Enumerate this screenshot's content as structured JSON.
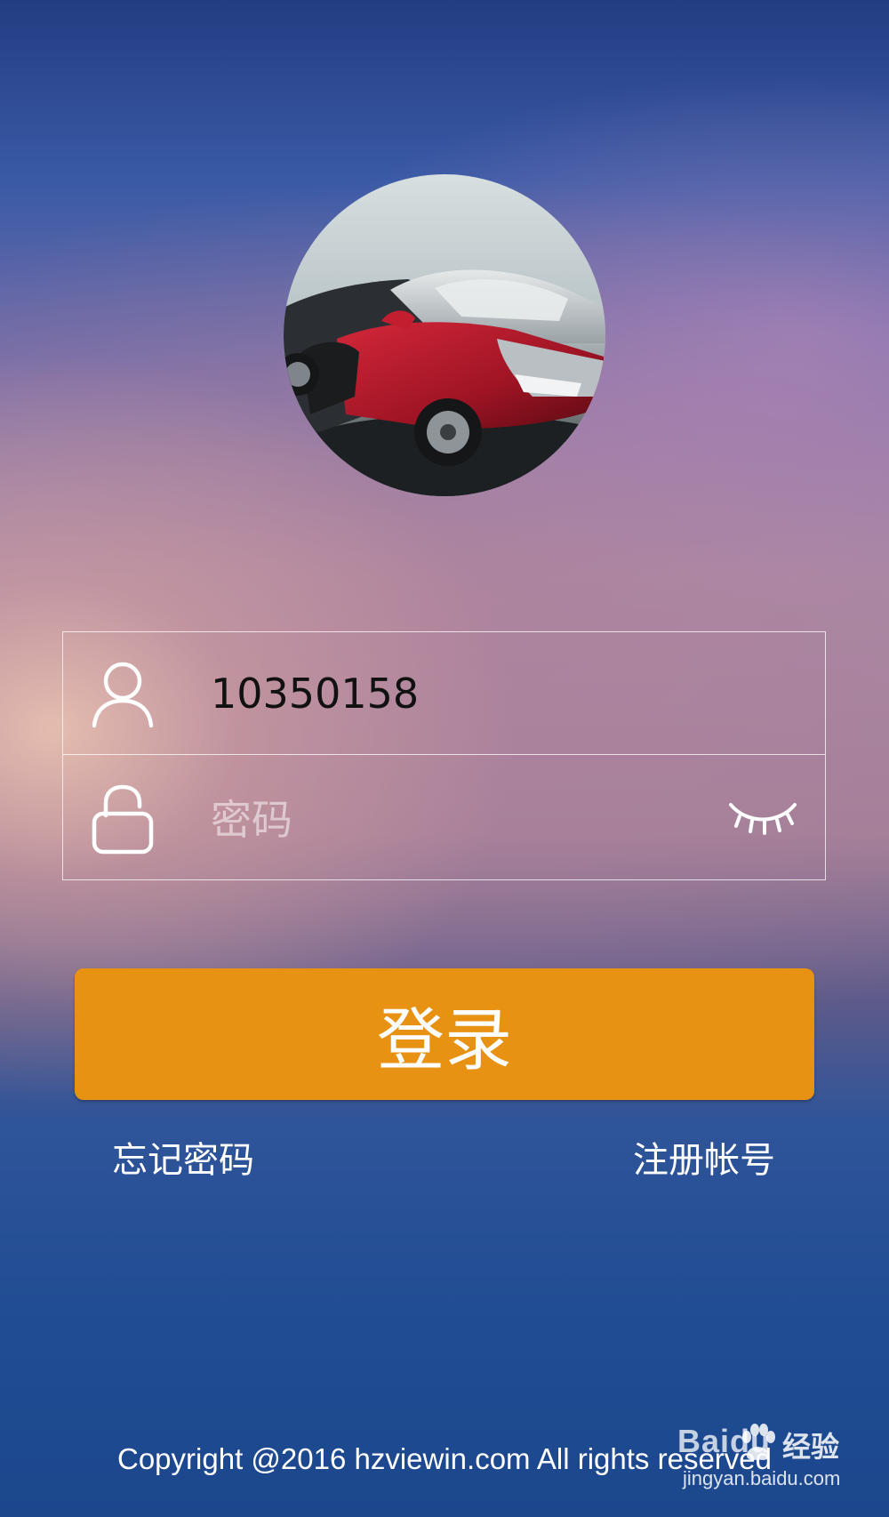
{
  "login_form": {
    "username_value": "10350158",
    "password_placeholder": "密码",
    "login_label": "登录",
    "forgot_password_label": "忘记密码",
    "register_label": "注册帐号"
  },
  "footer": {
    "copyright": "Copyright @2016 hzviewin.com All rights reserved"
  },
  "watermark": {
    "brand": "Baidu",
    "brand_cn": "经验",
    "url": "jingyan.baidu.com"
  },
  "icons": {
    "avatar": "red-sports-car-photo",
    "username": "user-icon",
    "password": "unlock-icon",
    "password_toggle": "closed-eye-icon"
  },
  "colors": {
    "login_button": "#e79212",
    "field_text": "#111111"
  }
}
